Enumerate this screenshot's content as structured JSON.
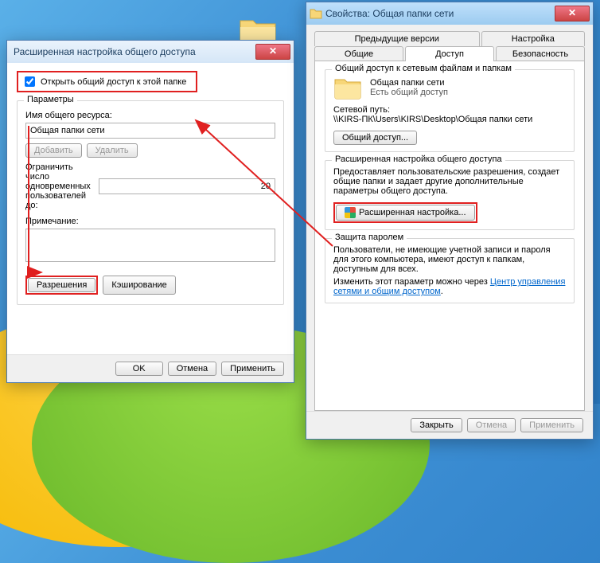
{
  "left": {
    "title": "Расширенная настройка общего доступа",
    "checkbox_label": "Открыть общий доступ к этой папке",
    "group_title": "Параметры",
    "share_name_label": "Имя общего ресурса:",
    "share_name_value": "Общая папки сети",
    "btn_add": "Добавить",
    "btn_remove": "Удалить",
    "limit_label": "Ограничить число одновременных пользователей до:",
    "limit_value": "20",
    "note_label": "Примечание:",
    "btn_permissions": "Разрешения",
    "btn_caching": "Кэширование",
    "btn_ok": "OK",
    "btn_cancel": "Отмена",
    "btn_apply": "Применить"
  },
  "right": {
    "title": "Свойства: Общая папки сети",
    "tabs": {
      "prev": "Предыдущие версии",
      "settings": "Настройка",
      "general": "Общие",
      "access": "Доступ",
      "security": "Безопасность"
    },
    "net_section_title": "Общий доступ к сетевым файлам и папкам",
    "folder_name": "Общая папки сети",
    "folder_status": "Есть общий доступ",
    "netpath_label": "Сетевой путь:",
    "netpath_value": "\\\\KIRS-ПК\\Users\\KIRS\\Desktop\\Общая папки сети",
    "btn_share": "Общий доступ...",
    "adv_section_title": "Расширенная настройка общего доступа",
    "adv_desc": "Предоставляет пользовательские разрешения, создает общие папки и задает другие дополнительные параметры общего доступа.",
    "btn_adv": "Расширенная настройка...",
    "pw_section_title": "Защита паролем",
    "pw_desc1": "Пользователи, не имеющие учетной записи и пароля для этого компьютера, имеют доступ к папкам, доступным для всех.",
    "pw_desc2_prefix": "Изменить этот параметр можно через ",
    "pw_link": "Центр управления сетями и общим доступом",
    "btn_close": "Закрыть",
    "btn_cancel": "Отмена",
    "btn_apply": "Применить"
  }
}
